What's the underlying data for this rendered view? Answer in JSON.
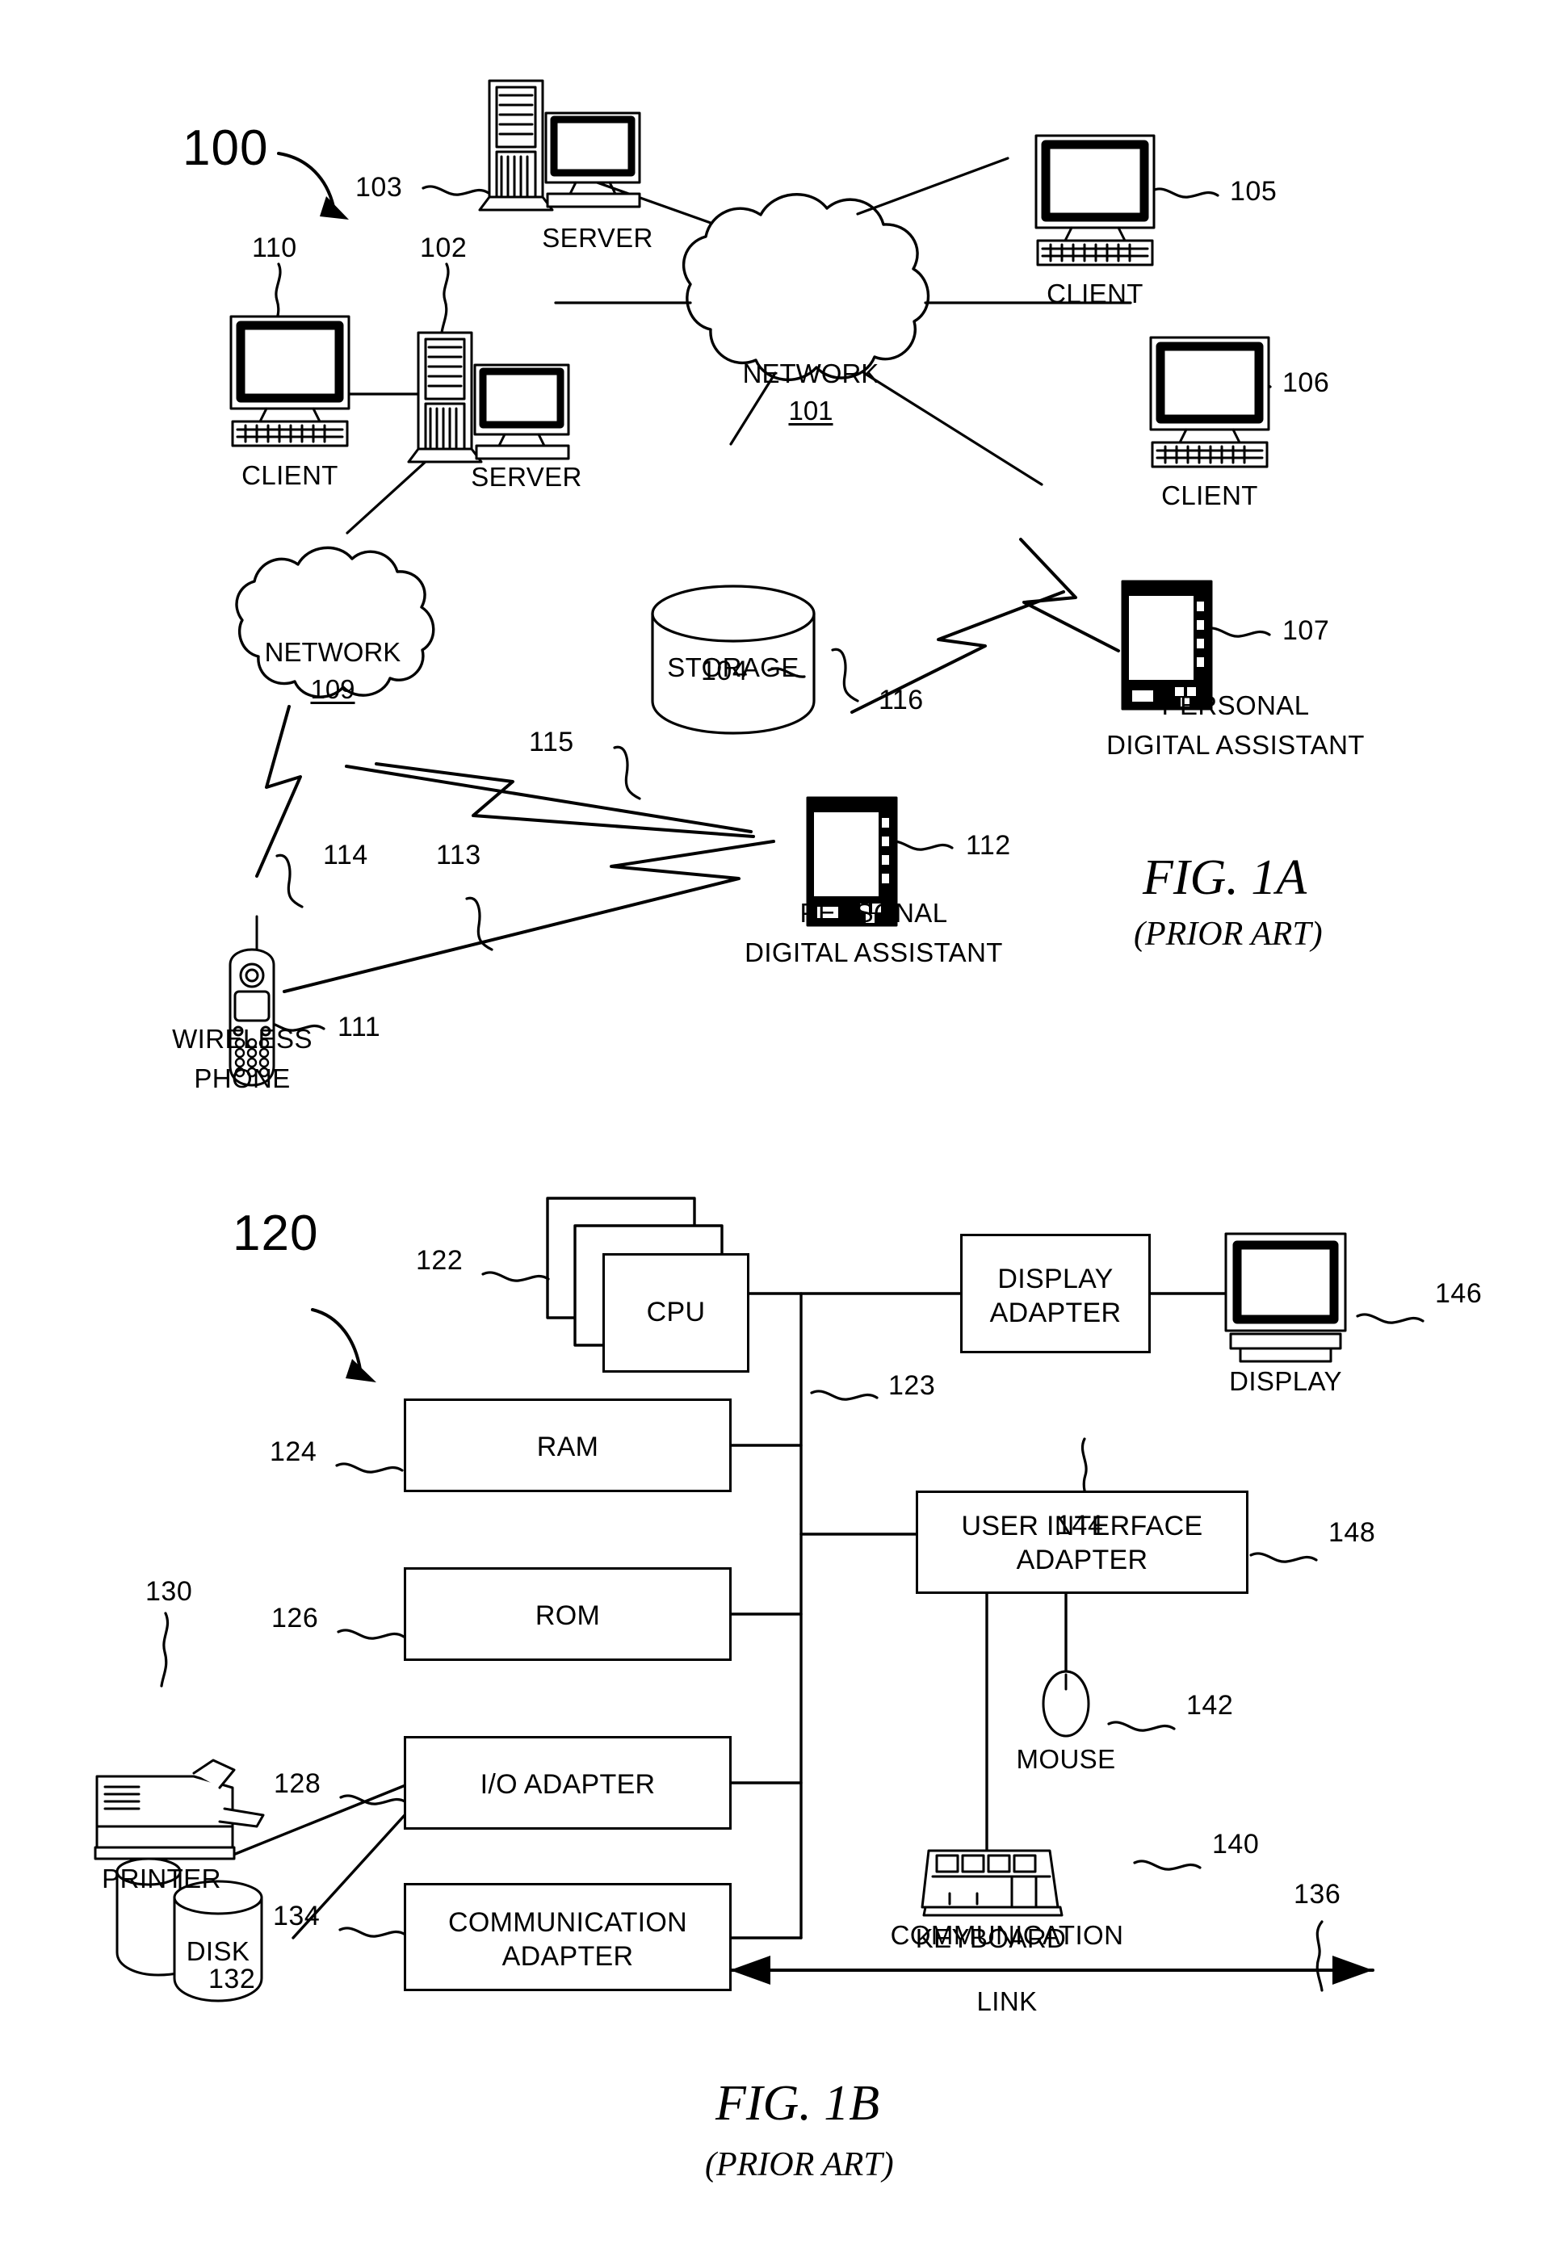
{
  "figures": [
    {
      "id": "fig-1a",
      "caption": "FIG. 1A",
      "subcaption": "(PRIOR ART)",
      "system_ref": "100",
      "nodes": [
        {
          "ref": "110",
          "label": "CLIENT",
          "icon": "desktop-computer-icon"
        },
        {
          "ref": "102",
          "label": "SERVER",
          "icon": "server-tower-icon"
        },
        {
          "ref": "103",
          "label": "SERVER",
          "icon": "server-tower-icon"
        },
        {
          "ref": "105",
          "label": "CLIENT",
          "icon": "desktop-computer-icon"
        },
        {
          "ref": "106",
          "label": "CLIENT",
          "icon": "desktop-computer-icon"
        },
        {
          "ref": "101",
          "label": "NETWORK",
          "icon": "cloud-icon"
        },
        {
          "ref": "109",
          "label": "NETWORK",
          "icon": "cloud-icon"
        },
        {
          "ref": "104",
          "label": "STORAGE",
          "icon": "database-cylinder-icon"
        },
        {
          "ref": "107",
          "label": "PERSONAL DIGITAL ASSISTANT",
          "icon": "pda-icon"
        },
        {
          "ref": "112",
          "label": "PERSONAL DIGITAL ASSISTANT",
          "icon": "pda-icon"
        },
        {
          "ref": "111",
          "label": "WIRELESS PHONE",
          "icon": "mobile-phone-icon"
        }
      ],
      "wireless_links": [
        "116",
        "115",
        "114",
        "113"
      ]
    },
    {
      "id": "fig-1b",
      "caption": "FIG. 1B",
      "subcaption": "(PRIOR ART)",
      "system_ref": "120",
      "blocks": [
        {
          "ref": "122",
          "label": "CPU"
        },
        {
          "ref": "124",
          "label": "RAM"
        },
        {
          "ref": "126",
          "label": "ROM"
        },
        {
          "ref": "128",
          "label": "I/O ADAPTER"
        },
        {
          "ref": "134",
          "label": "COMMUNICATION ADAPTER"
        },
        {
          "ref": "144",
          "label": "DISPLAY ADAPTER"
        },
        {
          "ref": "148",
          "label": "USER INTERFACE ADAPTER"
        }
      ],
      "peripherals": [
        {
          "ref": "130",
          "label": "PRINTER",
          "icon": "printer-icon"
        },
        {
          "ref": "132",
          "label": "DISK",
          "icon": "disk-cylinder-icon"
        },
        {
          "ref": "140",
          "label": "KEYBOARD",
          "icon": "keyboard-icon"
        },
        {
          "ref": "142",
          "label": "MOUSE",
          "icon": "mouse-icon"
        },
        {
          "ref": "146",
          "label": "DISPLAY",
          "icon": "monitor-icon"
        }
      ],
      "bus_ref": "123",
      "link": {
        "ref": "136",
        "label_line1": "COMMUNICATION",
        "label_line2": "LINK"
      }
    }
  ],
  "fig1a": {
    "sys": "100",
    "ref_110": "110",
    "ref_102": "102",
    "ref_103": "103",
    "ref_105": "105",
    "ref_106": "106",
    "ref_107": "107",
    "ref_104": "104",
    "ref_111": "111",
    "ref_112": "112",
    "ref_113": "113",
    "ref_114": "114",
    "ref_115": "115",
    "ref_116": "116",
    "label_client_110": "CLIENT",
    "label_server_102": "SERVER",
    "label_server_103": "SERVER",
    "label_client_105": "CLIENT",
    "label_client_106": "CLIENT",
    "network_101_name": "NETWORK",
    "network_101_num": "101",
    "network_109_name": "NETWORK",
    "network_109_num": "109",
    "label_storage": "STORAGE",
    "pda107_line1": "PERSONAL",
    "pda107_line2": "DIGITAL ASSISTANT",
    "pda112_line1": "PERSONAL",
    "pda112_line2": "DIGITAL ASSISTANT",
    "phone_line1": "WIRELESS",
    "phone_line2": "PHONE",
    "caption": "FIG. 1A",
    "subcaption": "(PRIOR ART)"
  },
  "fig1b": {
    "sys": "120",
    "ref_122": "122",
    "ref_123": "123",
    "ref_124": "124",
    "ref_126": "126",
    "ref_128": "128",
    "ref_130": "130",
    "ref_132": "132",
    "ref_134": "134",
    "ref_136": "136",
    "ref_140": "140",
    "ref_142": "142",
    "ref_144": "144",
    "ref_146": "146",
    "ref_148": "148",
    "block_cpu": "CPU",
    "block_ram": "RAM",
    "block_rom": "ROM",
    "block_io": "I/O ADAPTER",
    "block_comm_l1": "COMMUNICATION",
    "block_comm_l2": "ADAPTER",
    "block_display_l1": "DISPLAY",
    "block_display_l2": "ADAPTER",
    "block_ui_l1": "USER INTERFACE",
    "block_ui_l2": "ADAPTER",
    "label_printer": "PRINTER",
    "label_disk": "DISK",
    "label_keyboard": "KEYBOARD",
    "label_mouse": "MOUSE",
    "label_display": "DISPLAY",
    "link_l1": "COMMUNICATION",
    "link_l2": "LINK",
    "caption": "FIG. 1B",
    "subcaption": "(PRIOR ART)"
  },
  "colors": {
    "ink": "#000000",
    "paper": "#ffffff"
  }
}
